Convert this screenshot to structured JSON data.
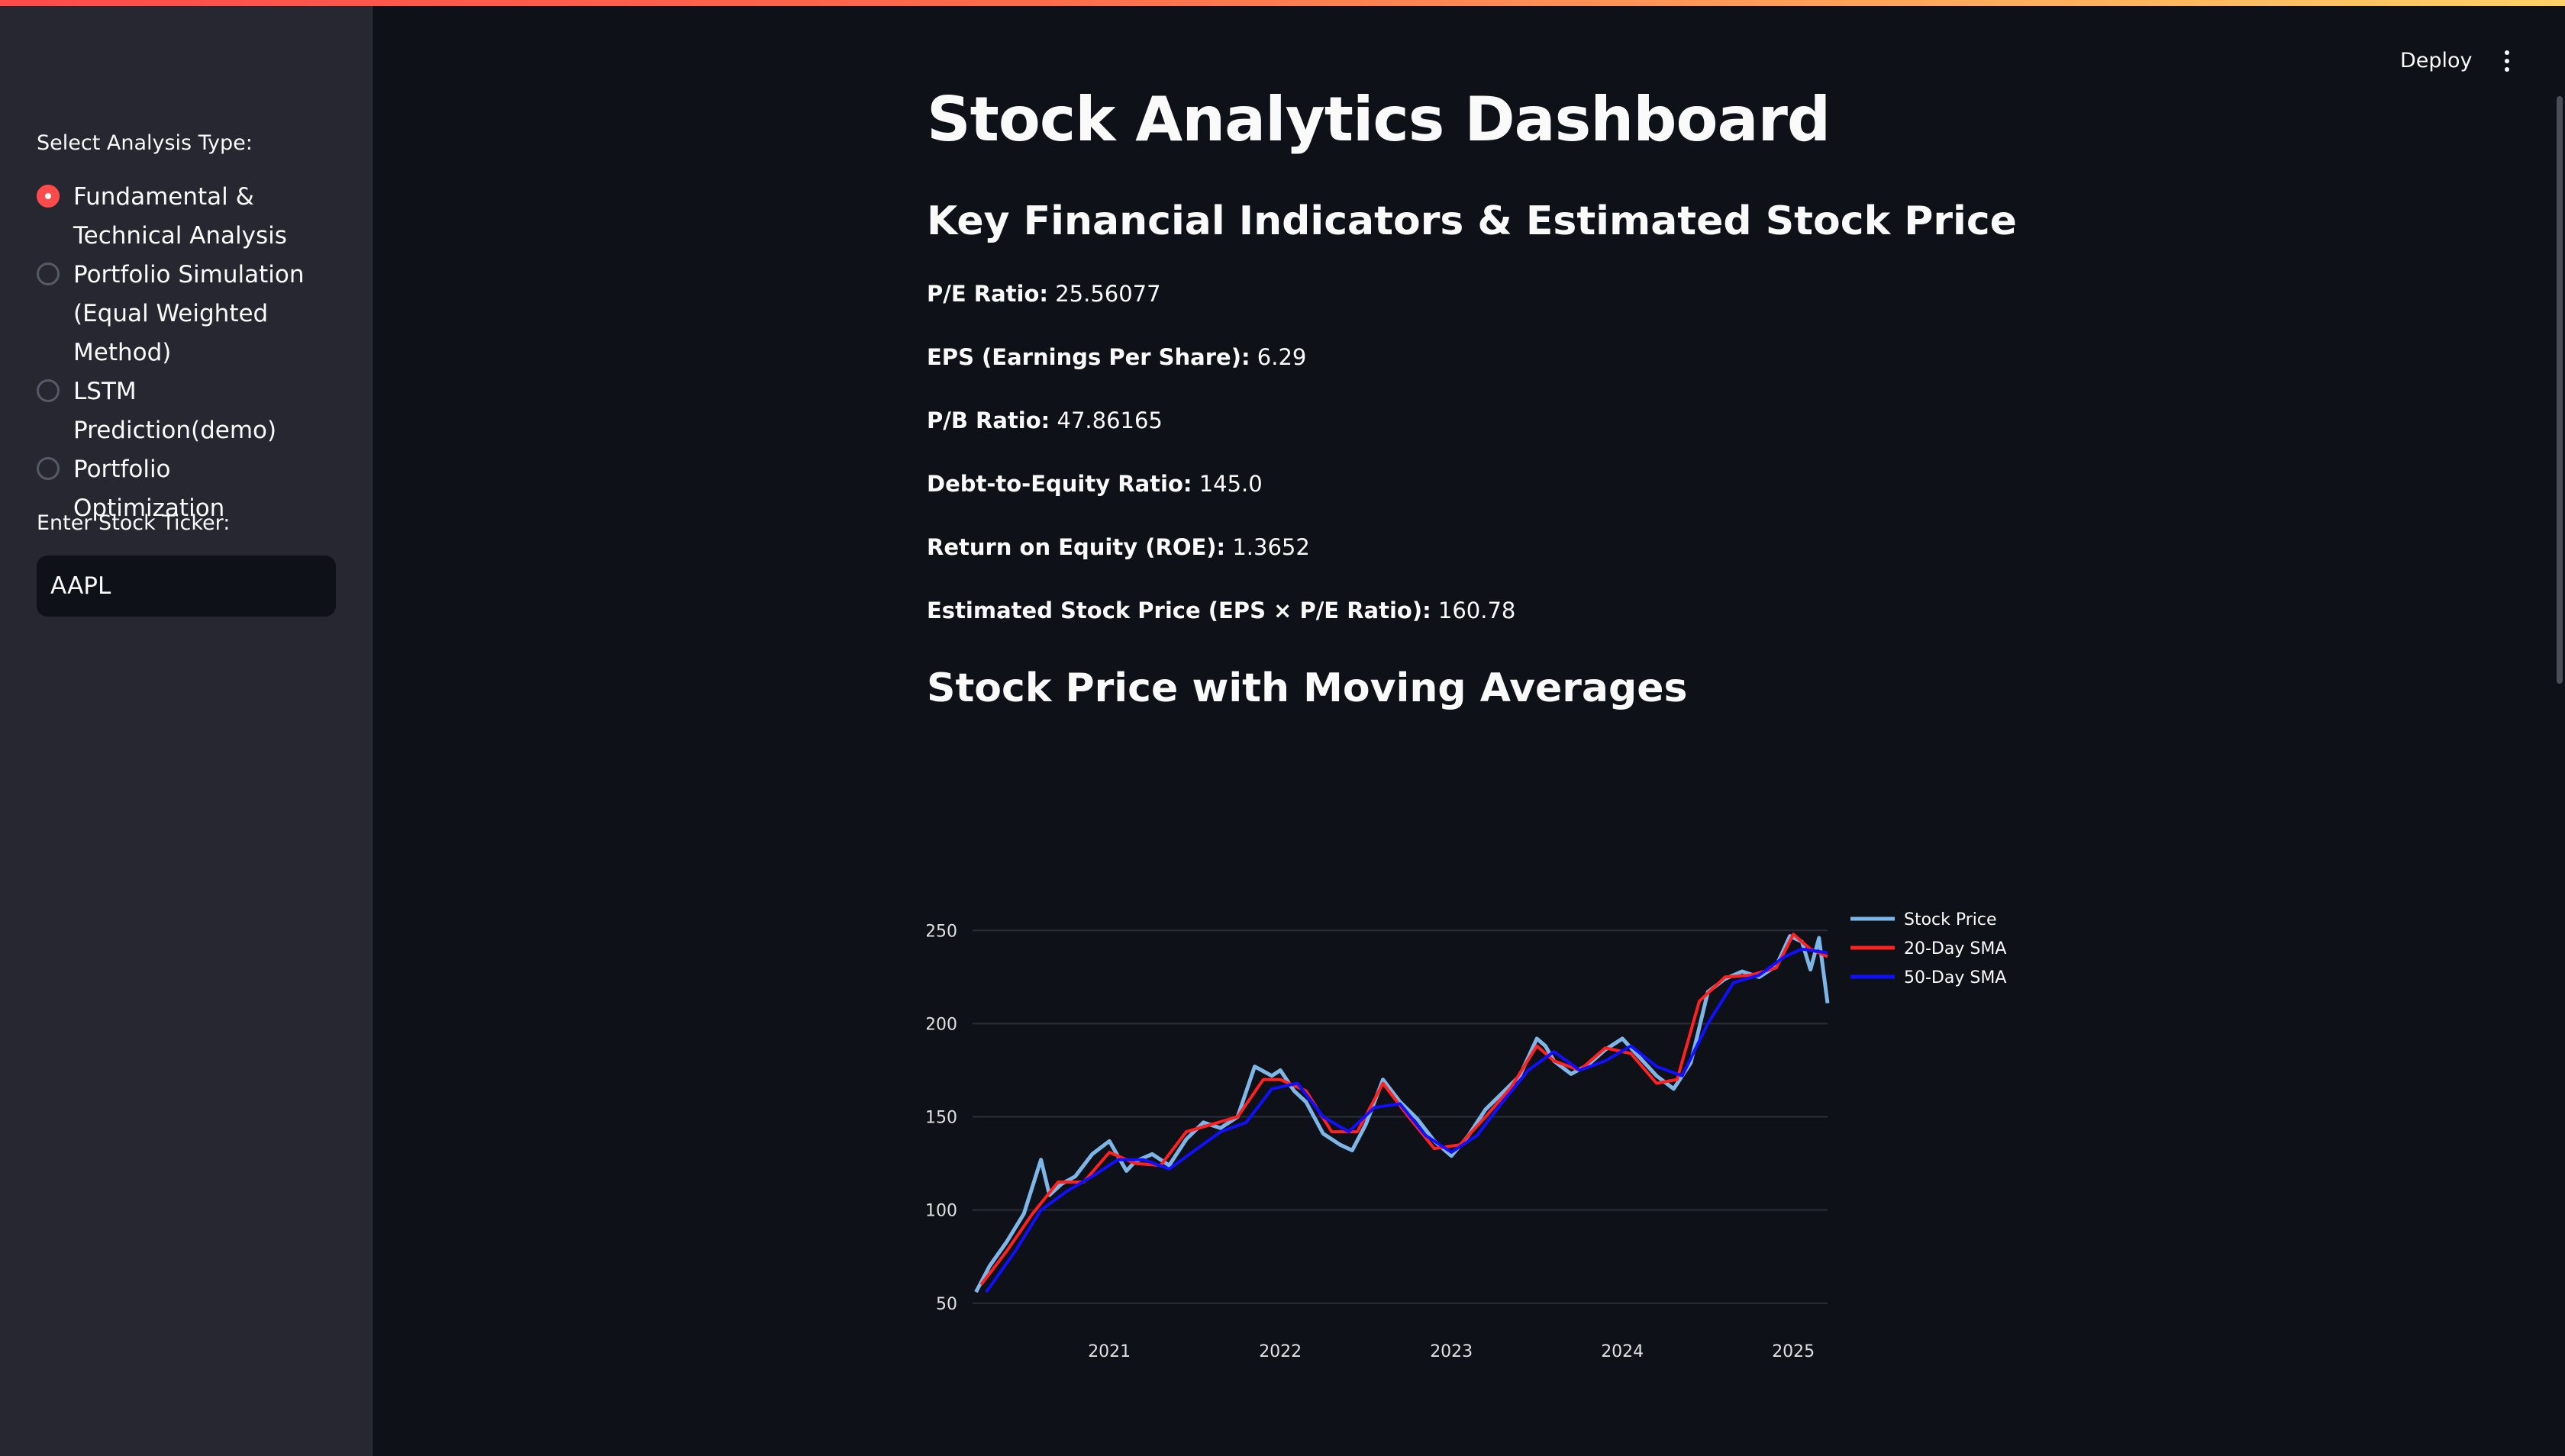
{
  "sidebar": {
    "analysis_label": "Select Analysis Type:",
    "analysis_options": [
      {
        "label": "Fundamental & Technical Analysis",
        "checked": true
      },
      {
        "label": "Portfolio Simulation (Equal Weighted Method)",
        "checked": false
      },
      {
        "label": "LSTM Prediction(demo)",
        "checked": false
      },
      {
        "label": "Portfolio Optimization",
        "checked": false
      }
    ],
    "ticker_label": "Enter Stock Ticker:",
    "ticker_value": "AAPL"
  },
  "header": {
    "deploy_label": "Deploy",
    "menu_icon": "vertical-dots-icon"
  },
  "main": {
    "title": "Stock Analytics Dashboard",
    "indicators_heading": "Key Financial Indicators & Estimated Stock Price",
    "metrics": [
      {
        "label": "P/E Ratio:",
        "value": "25.56077"
      },
      {
        "label": "EPS (Earnings Per Share):",
        "value": "6.29"
      },
      {
        "label": "P/B Ratio:",
        "value": "47.86165"
      },
      {
        "label": "Debt-to-Equity Ratio:",
        "value": "145.0"
      },
      {
        "label": "Return on Equity (ROE):",
        "value": "1.3652"
      },
      {
        "label": "Estimated Stock Price (EPS × P/E Ratio):",
        "value": "160.78"
      }
    ],
    "chart_heading": "Stock Price with Moving Averages"
  },
  "colors": {
    "accent": "#ff4b4b",
    "background": "#0e1117",
    "sidebar": "#262730"
  },
  "chart_data": {
    "type": "line",
    "title": "",
    "xlabel": "",
    "ylabel": "",
    "ylim": [
      45,
      262
    ],
    "xlim": [
      2020.2,
      2025.2
    ],
    "yticks": [
      50,
      100,
      150,
      200,
      250
    ],
    "xticks": [
      2021,
      2022,
      2023,
      2024,
      2025
    ],
    "xtick_labels": [
      "2021",
      "2022",
      "2023",
      "2024",
      "2025"
    ],
    "grid": true,
    "legend_position": "top-right",
    "series": [
      {
        "name": "Stock Price",
        "color": "#7eb6e8",
        "x": [
          2020.22,
          2020.3,
          2020.4,
          2020.5,
          2020.6,
          2020.65,
          2020.72,
          2020.8,
          2020.9,
          2021.0,
          2021.1,
          2021.15,
          2021.25,
          2021.35,
          2021.45,
          2021.55,
          2021.65,
          2021.75,
          2021.85,
          2021.95,
          2022.0,
          2022.08,
          2022.15,
          2022.25,
          2022.35,
          2022.42,
          2022.5,
          2022.6,
          2022.7,
          2022.8,
          2022.9,
          2023.0,
          2023.1,
          2023.2,
          2023.3,
          2023.4,
          2023.5,
          2023.55,
          2023.6,
          2023.7,
          2023.8,
          2023.9,
          2024.0,
          2024.1,
          2024.2,
          2024.3,
          2024.4,
          2024.5,
          2024.6,
          2024.7,
          2024.8,
          2024.9,
          2024.98,
          2025.05,
          2025.1,
          2025.15,
          2025.2
        ],
        "y": [
          56,
          70,
          83,
          98,
          127,
          108,
          114,
          118,
          130,
          137,
          121,
          126,
          130,
          124,
          138,
          147,
          144,
          150,
          177,
          172,
          175,
          164,
          158,
          141,
          135,
          132,
          146,
          170,
          158,
          149,
          137,
          129,
          140,
          154,
          163,
          172,
          192,
          188,
          180,
          173,
          178,
          186,
          192,
          182,
          172,
          165,
          179,
          217,
          224,
          228,
          225,
          231,
          247,
          244,
          229,
          246,
          211
        ]
      },
      {
        "name": "20-Day SMA",
        "color": "#ff2020",
        "x": [
          2020.25,
          2020.4,
          2020.55,
          2020.7,
          2020.85,
          2021.0,
          2021.15,
          2021.3,
          2021.45,
          2021.6,
          2021.75,
          2021.9,
          2022.0,
          2022.15,
          2022.3,
          2022.45,
          2022.6,
          2022.75,
          2022.9,
          2023.05,
          2023.2,
          2023.35,
          2023.5,
          2023.6,
          2023.75,
          2023.9,
          2024.05,
          2024.2,
          2024.32,
          2024.45,
          2024.6,
          2024.75,
          2024.9,
          2025.0,
          2025.1,
          2025.2
        ],
        "y": [
          60,
          78,
          98,
          115,
          115,
          131,
          125,
          124,
          142,
          146,
          150,
          170,
          170,
          164,
          142,
          142,
          168,
          150,
          133,
          135,
          150,
          166,
          188,
          180,
          175,
          187,
          184,
          168,
          170,
          212,
          225,
          226,
          230,
          248,
          240,
          236
        ]
      },
      {
        "name": "50-Day SMA",
        "color": "#1010ff",
        "x": [
          2020.28,
          2020.45,
          2020.6,
          2020.75,
          2020.9,
          2021.05,
          2021.2,
          2021.35,
          2021.5,
          2021.65,
          2021.8,
          2021.95,
          2022.1,
          2022.25,
          2022.4,
          2022.55,
          2022.7,
          2022.85,
          2023.0,
          2023.15,
          2023.3,
          2023.45,
          2023.6,
          2023.75,
          2023.9,
          2024.05,
          2024.2,
          2024.35,
          2024.5,
          2024.65,
          2024.8,
          2024.95,
          2025.05,
          2025.2
        ],
        "y": [
          56,
          78,
          100,
          110,
          118,
          127,
          127,
          122,
          132,
          142,
          147,
          165,
          168,
          150,
          142,
          155,
          157,
          140,
          131,
          140,
          158,
          175,
          185,
          175,
          180,
          188,
          177,
          172,
          200,
          222,
          226,
          236,
          240,
          238
        ]
      }
    ]
  }
}
